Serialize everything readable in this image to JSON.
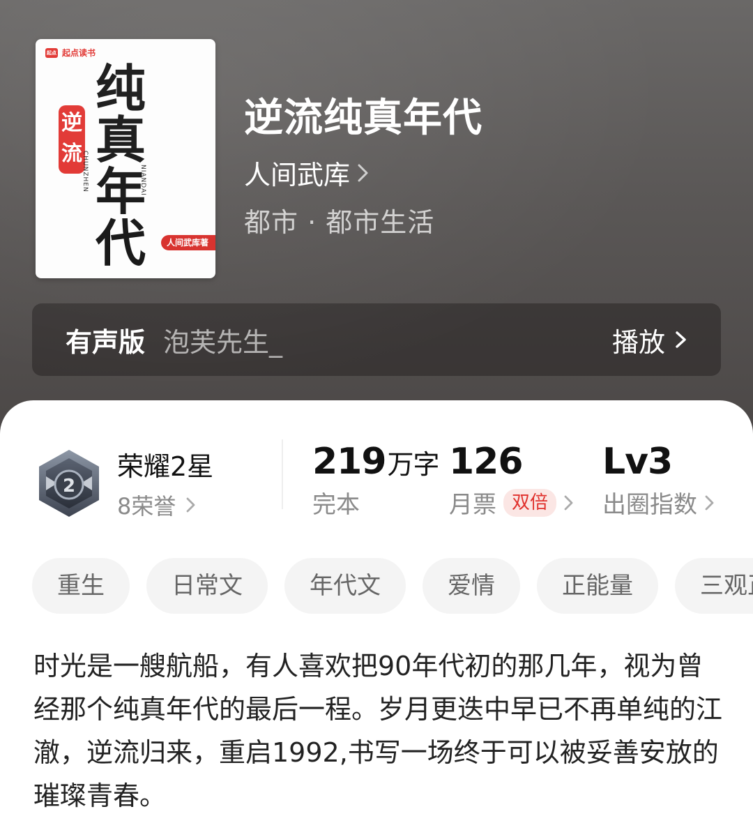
{
  "book": {
    "title": "逆流纯真年代",
    "author": "人间武库",
    "genre": "都市 · 都市生活",
    "cover": {
      "brand": "起点读书",
      "brand_logo": "起点",
      "red_text": "逆流",
      "big_text": "纯真年代",
      "pinyin_left": "CHUNZHEN",
      "pinyin_right": "NIANDAI",
      "author_tag": "人间武库著"
    }
  },
  "audio": {
    "label": "有声版",
    "narrator": "泡芙先生_",
    "play_label": "播放"
  },
  "honor": {
    "title": "荣耀2星",
    "sub": "8荣誉",
    "badge_level": "2"
  },
  "stats": {
    "words_value": "219",
    "words_unit": "万字",
    "words_label": "完本",
    "votes_value": "126",
    "votes_label": "月票",
    "votes_badge": "双倍",
    "index_value": "Lv3",
    "index_label": "出圈指数"
  },
  "tags": [
    "重生",
    "日常文",
    "年代文",
    "爱情",
    "正能量",
    "三观正"
  ],
  "description": "时光是一艘航船，有人喜欢把90年代初的那几年，视为曾经那个纯真年代的最后一程。岁月更迭中早已不再单纯的江澈，逆流归来，重启1992,书写一场终于可以被妥善安放的璀璨青春。",
  "colors": {
    "accent_red": "#e0302c",
    "hero_bg": "#5a5756"
  }
}
